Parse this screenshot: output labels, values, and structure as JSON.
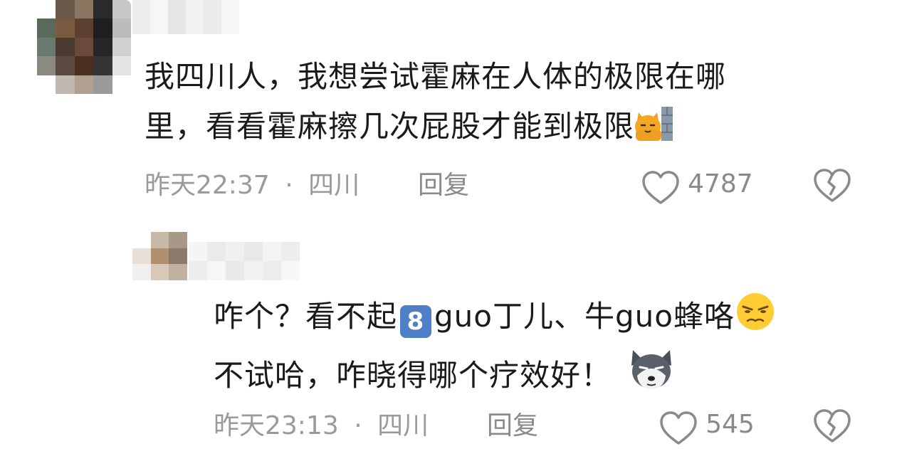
{
  "comments": [
    {
      "line1": "我四川人，我想尝试霍麻在人体的极限在哪",
      "line2": "里，看看霍麻擦几次屁股才能到极限",
      "time": "昨天22:37",
      "location": "四川",
      "sep": "·",
      "reply_label": "回复",
      "likes": "4787",
      "trailing_emoji": "cat-behind-wall-emoji"
    },
    {
      "line1_a": "咋个？看不起",
      "line1_badge": "8",
      "line1_b": "guo丁儿、牛guo蜂咯",
      "line2": "不试哈，咋晓得哪个疗效好！",
      "time": "昨天23:13",
      "location": "四川",
      "sep": "·",
      "reply_label": "回复",
      "likes": "545",
      "emoji_1": "smirk-face-emoji",
      "emoji_2": "husky-dog-emoji"
    }
  ],
  "colors": {
    "text": "#1a1a1a",
    "meta": "#9a9a9a",
    "icon": "#8a8a8a",
    "badge": "#4f7fc7"
  }
}
